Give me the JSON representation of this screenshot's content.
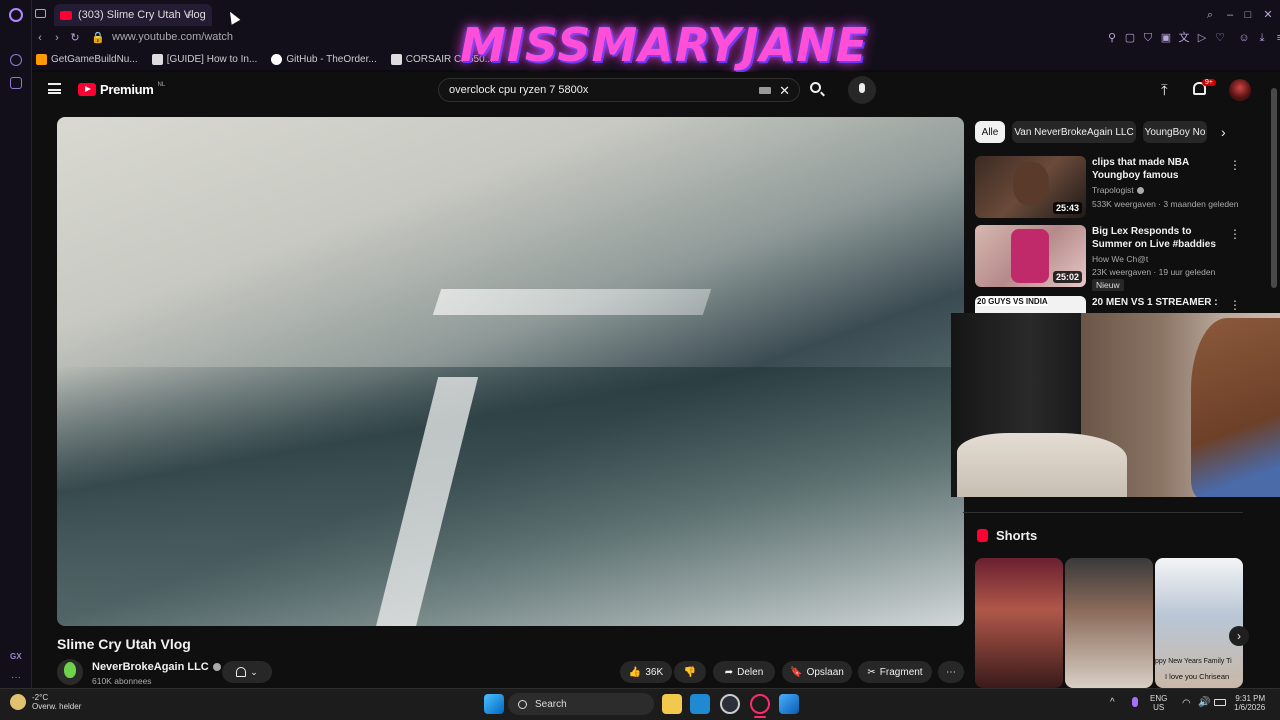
{
  "browser": {
    "tab_title": "(303) Slime Cry Utah Vlog",
    "new_tab_symbol": "+",
    "url": "www.youtube.com/watch",
    "bookmarks": [
      {
        "label": "GetGameBuildNu...",
        "icon": "amazon-icon"
      },
      {
        "label": "[GUIDE] How to In...",
        "icon": "forum-icon"
      },
      {
        "label": "GitHub - TheOrder...",
        "icon": "github-icon"
      },
      {
        "label": "CORSAIR CX550...",
        "icon": "amazon-icon"
      }
    ],
    "overlay_text": "MISSMARYJANE",
    "sidebar_label": "GX"
  },
  "youtube": {
    "logo_text": "Premium",
    "logo_region": "NL",
    "search_value": "overclock cpu ryzen 7 5800x",
    "notification_badge": "9+"
  },
  "video": {
    "title": "Slime Cry Utah Vlog",
    "channel": "NeverBrokeAgain LLC",
    "subscribers": "610K abonnees",
    "likes": "36K",
    "share_label": "Delen",
    "save_label": "Opslaan",
    "clip_label": "Fragment"
  },
  "chips": [
    "Alle",
    "Van NeverBrokeAgain LLC",
    "YoungBoy No"
  ],
  "recommendations": [
    {
      "title": "clips that made NBA Youngboy famous",
      "channel": "Trapologist",
      "meta": "533K weergaven · 3 maanden geleden",
      "duration": "25:43",
      "badge": ""
    },
    {
      "title": "Big Lex Responds to Summer on Live #baddies",
      "channel": "How We Ch@t",
      "meta": "23K weergaven · 19 uur geleden",
      "duration": "25:02",
      "badge": "Nieuw"
    },
    {
      "title": "20 MEN VS 1 STREAMER :",
      "channel": "",
      "meta": "",
      "duration": "",
      "badge": "",
      "thumb_text": "20 GUYS VS INDIA"
    }
  ],
  "shorts": {
    "heading": "Shorts",
    "items": [
      {
        "caption": ""
      },
      {
        "caption": ""
      },
      {
        "caption": "I love you Chrisean",
        "overlay": "ppy New Years Family Ti"
      }
    ]
  },
  "taskbar": {
    "temperature": "-2°C",
    "weather": "Overw. helder",
    "search_label": "Search",
    "language": "ENG",
    "region": "US",
    "time": "9:31 PM",
    "date": "1/6/2026"
  }
}
